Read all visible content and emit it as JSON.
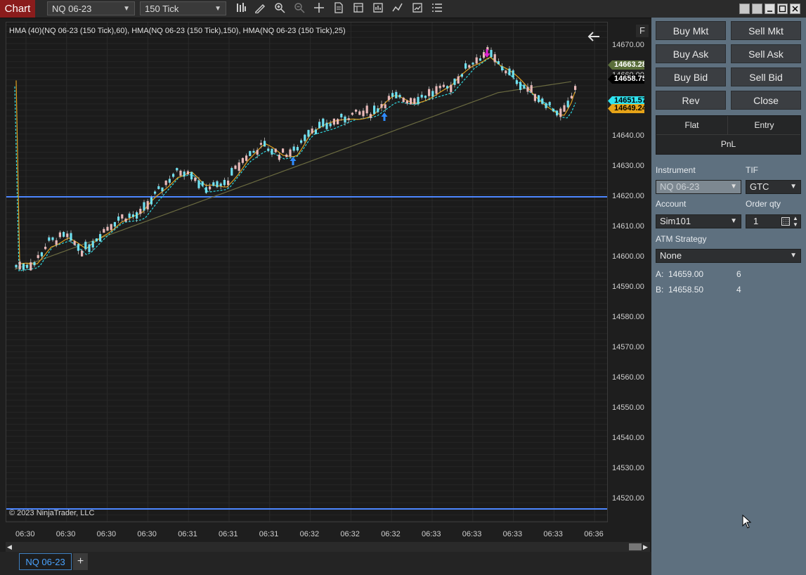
{
  "toolbar": {
    "chart_label": "Chart",
    "instrument": "NQ 06-23",
    "interval": "150 Tick"
  },
  "chart": {
    "indicator_label": "HMA (40)(NQ 06-23 (150 Tick),60), HMA(NQ 06-23 (150 Tick),150), HMA(NQ 06-23 (150 Tick),25)",
    "copyright": "© 2023 NinjaTrader, LLC",
    "f_button": "F",
    "colors": {
      "up": "#6fe0f0",
      "down": "#e8b8b8",
      "hma_fast": "#e0a020",
      "hma_mid": "#2fd8e0",
      "hma_slow": "#6a6a40",
      "hline": "#4c86ff"
    }
  },
  "price_axis": {
    "ticks": [
      "14670.00",
      "14660.00",
      "14650.00",
      "14640.00",
      "14630.00",
      "14620.00",
      "14610.00",
      "14600.00",
      "14590.00",
      "14580.00",
      "14570.00",
      "14560.00",
      "14550.00",
      "14540.00",
      "14530.00",
      "14520.00"
    ],
    "tags": [
      {
        "value": "14663.28",
        "bg": "#5a6e3a",
        "fg": "#ffffff"
      },
      {
        "value": "14658.75",
        "bg": "#000000",
        "fg": "#ffffff"
      },
      {
        "value": "14651.57",
        "bg": "#2fe4f0",
        "fg": "#000000"
      },
      {
        "value": "14649.24",
        "bg": "#e6a318",
        "fg": "#000000"
      }
    ]
  },
  "time_axis": {
    "ticks": [
      "06:30",
      "06:30",
      "06:30",
      "06:30",
      "06:31",
      "06:31",
      "06:31",
      "06:32",
      "06:32",
      "06:32",
      "06:33",
      "06:33",
      "06:33",
      "06:33",
      "06:36"
    ]
  },
  "tabs": {
    "active": "NQ 06-23",
    "add": "+"
  },
  "panel": {
    "buttons": {
      "buy_mkt": "Buy Mkt",
      "sell_mkt": "Sell Mkt",
      "buy_ask": "Buy Ask",
      "sell_ask": "Sell Ask",
      "buy_bid": "Buy Bid",
      "sell_bid": "Sell Bid",
      "rev": "Rev",
      "close": "Close"
    },
    "position": {
      "flat": "Flat",
      "entry": "Entry",
      "pnl": "PnL"
    },
    "instrument_label": "Instrument",
    "instrument_value": "NQ 06-23",
    "tif_label": "TIF",
    "tif_value": "GTC",
    "account_label": "Account",
    "account_value": "Sim101",
    "qty_label": "Order qty",
    "qty_value": "1",
    "atm_label": "ATM Strategy",
    "atm_value": "None",
    "ask_label": "A:",
    "ask_price": "14659.00",
    "ask_size": "6",
    "bid_label": "B:",
    "bid_price": "14658.50",
    "bid_size": "4"
  }
}
